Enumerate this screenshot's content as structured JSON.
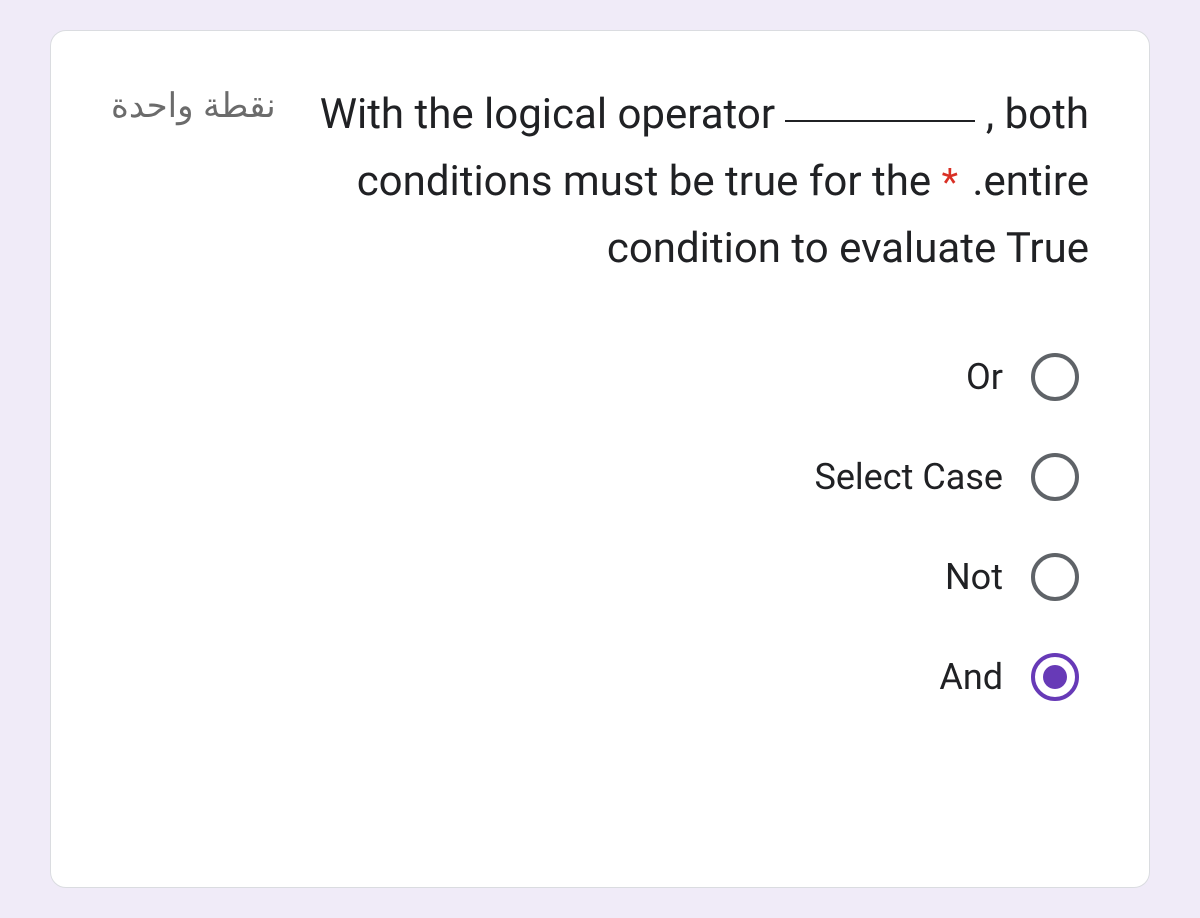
{
  "question": {
    "points_label": "نقطة واحدة",
    "text_part1": "With the logical operator ",
    "text_part2": " , both conditions must be true for the entire condition to evaluate True.",
    "required_star": "*"
  },
  "options": [
    {
      "label": "Or",
      "selected": false
    },
    {
      "label": "Select Case",
      "selected": false
    },
    {
      "label": "Not",
      "selected": false
    },
    {
      "label": "And",
      "selected": true
    }
  ]
}
